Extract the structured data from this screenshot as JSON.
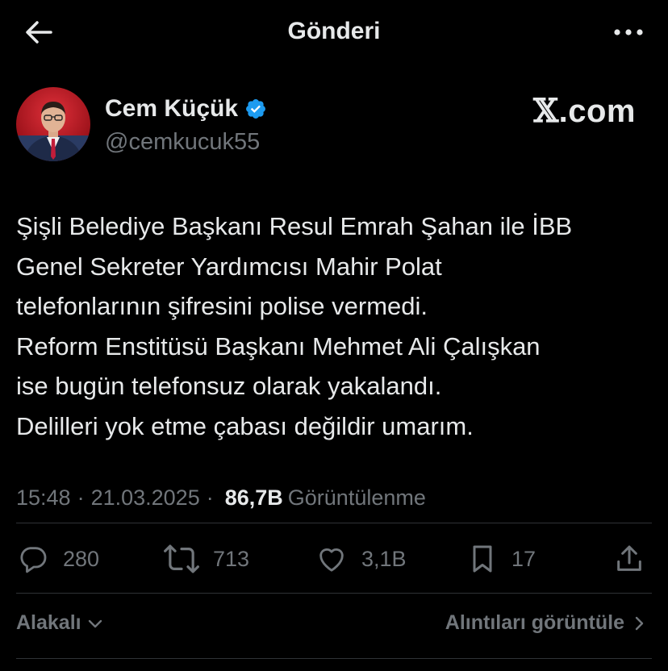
{
  "header": {
    "title": "Gönderi",
    "back_icon": "arrow-left-icon",
    "more_icon": "more-horizontal-icon"
  },
  "author": {
    "name": "Cem Küçük",
    "handle": "@cemkucuk55",
    "verified_color": "#1d9bf0"
  },
  "watermark": {
    "x": "𝕏",
    "suffix": ".com"
  },
  "tweet": {
    "text": "Şişli Belediye Başkanı Resul Emrah Şahan ile İBB\nGenel Sekreter Yardımcısı Mahir Polat\ntelefonlarının şifresini polise vermedi.\nReform Enstitüsü Başkanı Mehmet Ali Çalışkan\nise bugün telefonsuz olarak yakalandı.\nDelilleri yok etme çabası değildir umarım.",
    "time": "15:48",
    "date": "21.03.2025",
    "views_count": "86,7B",
    "views_label": "Görüntülenme"
  },
  "actions": {
    "replies": "280",
    "reposts": "713",
    "likes": "3,1B",
    "bookmarks": "17"
  },
  "footer": {
    "related_label": "Alakalı",
    "quotes_label": "Alıntıları görüntüle"
  },
  "colors": {
    "background": "#000000",
    "text": "#e7e9ea",
    "secondary": "#71767b",
    "divider": "#2f3336",
    "accent": "#1d9bf0"
  }
}
